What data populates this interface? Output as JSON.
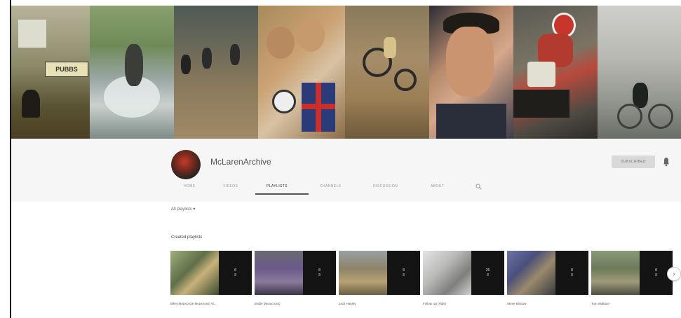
{
  "channel": {
    "name": "McLarenArchive",
    "subscribe_label": "SUBSCRIBED"
  },
  "tabs": [
    {
      "label": "HOME"
    },
    {
      "label": "VIDEOS"
    },
    {
      "label": "PLAYLISTS",
      "active": true
    },
    {
      "label": "CHANNELS"
    },
    {
      "label": "DISCUSSION"
    },
    {
      "label": "ABOUT"
    }
  ],
  "filter": {
    "label": "All playlists ▾"
  },
  "section": {
    "title": "Created playlists"
  },
  "playlists": [
    {
      "title": "Bike (Motorcycle Motocross) Vi...",
      "count": "8"
    },
    {
      "title": "Bridle (Motocross)",
      "count": "8"
    },
    {
      "title": "Jack Hanley",
      "count": "8"
    },
    {
      "title": "Follow Up (Vids)",
      "count": "26"
    },
    {
      "title": "Steve Bristow",
      "count": "8"
    },
    {
      "title": "Tom Wallace",
      "count": "8"
    }
  ],
  "banner": {
    "sign_text": "PUBBS"
  },
  "colors": {
    "header_band": "#f6f6f6",
    "active_tab_underline": "#555555"
  }
}
